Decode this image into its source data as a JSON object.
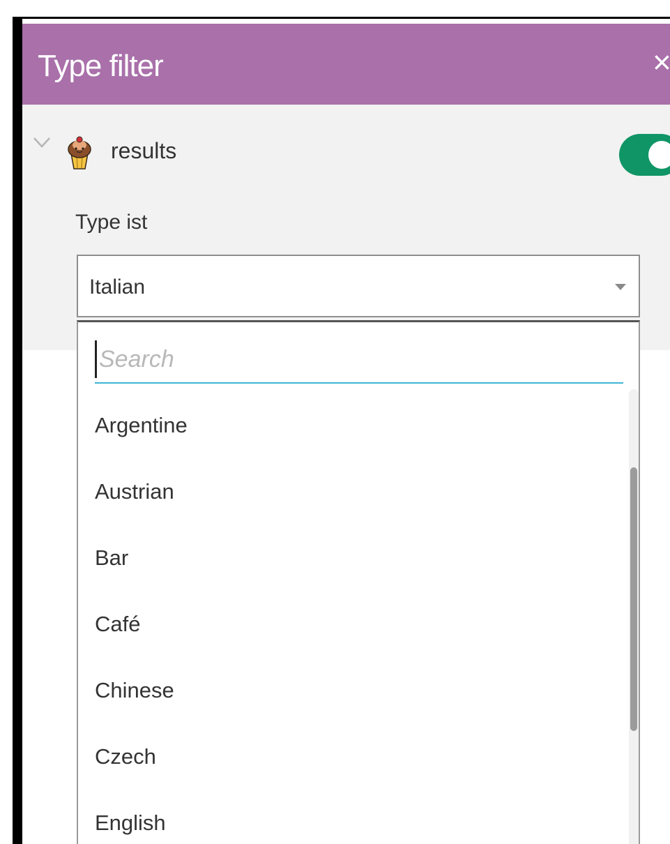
{
  "colors": {
    "header_bg": "#a970aa",
    "toggle_on": "#0f9566",
    "search_underline": "#3db5d6"
  },
  "header": {
    "title": "Type filter",
    "close_glyph": "×",
    "close_icon": "close-icon"
  },
  "layer": {
    "expand_icon": "chevron-down-icon",
    "avatar_icon": "cupcake-icon",
    "name": "results",
    "toggle_on": true
  },
  "filter": {
    "label": "Type ist",
    "selected_value": "Italian",
    "dropdown_icon": "caret-down-icon"
  },
  "dropdown": {
    "search_placeholder": "Search",
    "search_value": "",
    "options": [
      "Argentine",
      "Austrian",
      "Bar",
      "Café",
      "Chinese",
      "Czech",
      "English"
    ]
  }
}
